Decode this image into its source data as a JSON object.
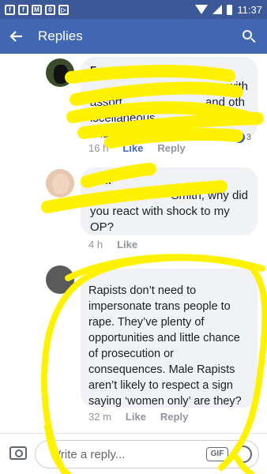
{
  "status_bar": {
    "time": "11:37"
  },
  "app_bar": {
    "title": "Replies"
  },
  "comments": [
    {
      "author": "F",
      "lines": [
        "with",
        "assort",
        "and oth",
        "iscellaneous",
        "char"
      ],
      "timestamp": "16 h",
      "like_label": "Like",
      "reply_label": "Reply",
      "reaction_count": "3"
    },
    {
      "author": "Vick",
      "lines": [
        "Smith, why did",
        "you react with shock to my",
        "OP?"
      ],
      "timestamp": "4 h",
      "like_label": "Like"
    },
    {
      "lines": [
        "Rapists don’t need to",
        "impersonate trans people to",
        "rape. They’ve plenty of",
        "opportunities and little chance",
        "of prosecution or",
        "consequences. Male Rapists",
        "aren’t likely to respect a sign",
        "saying ‘women only’ are they?"
      ],
      "timestamp": "32 m",
      "like_label": "Like",
      "reply_label": "Reply"
    }
  ],
  "composer": {
    "placeholder": "Write a reply...",
    "gif_label": "GIF"
  },
  "colors": {
    "facebook_blue": "#4267b2",
    "status_bar": "#3b5998",
    "highlight_yellow": "#fff200"
  }
}
